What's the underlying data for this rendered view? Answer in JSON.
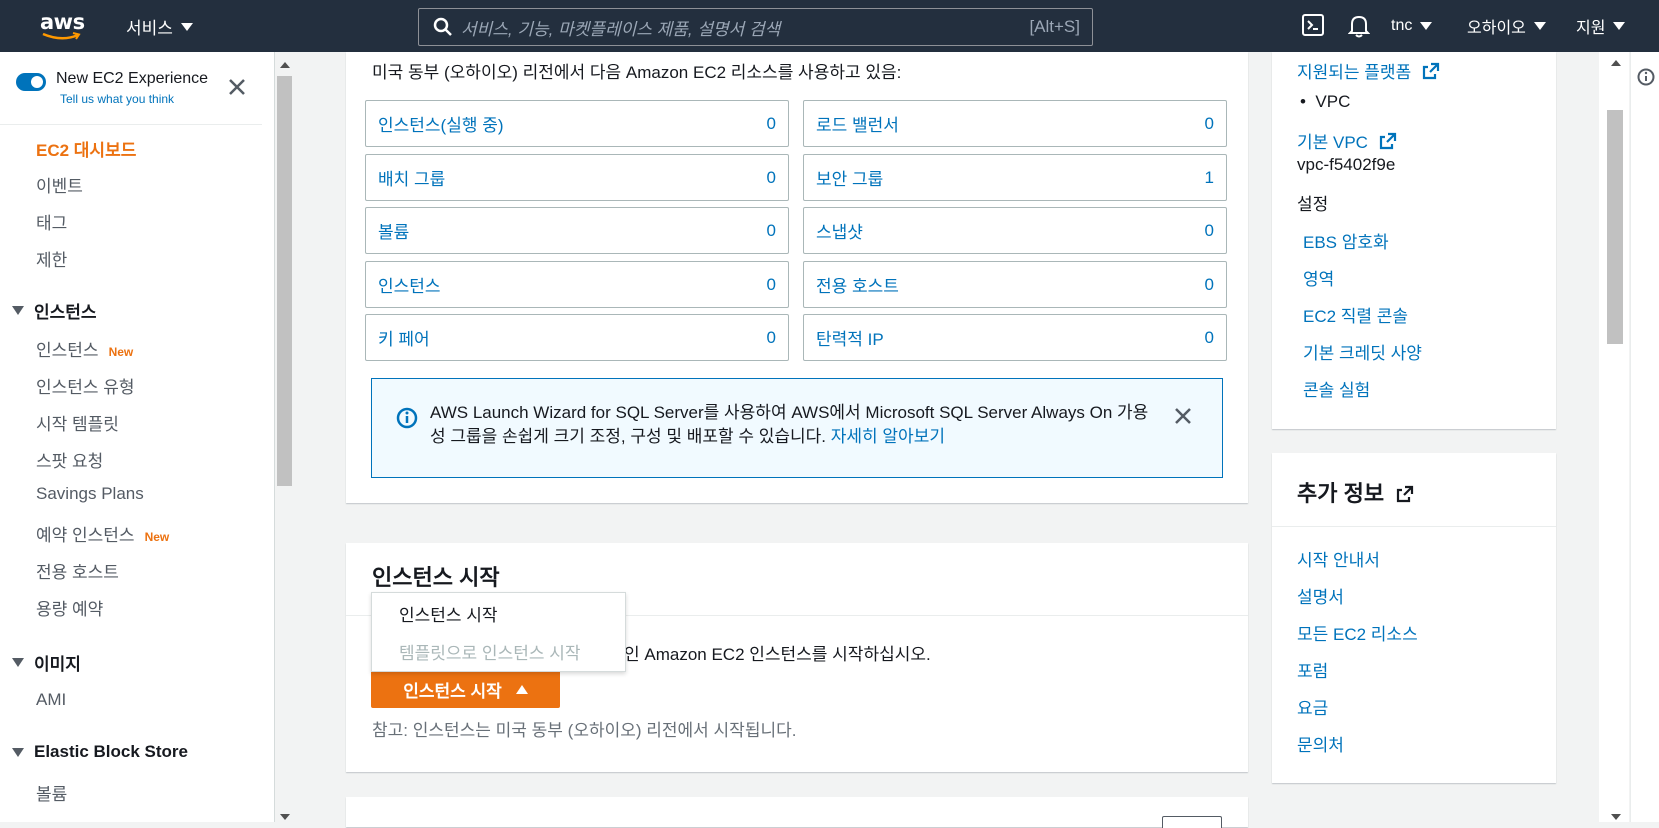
{
  "topnav": {
    "logo_text": "aws",
    "services_label": "서비스",
    "search_placeholder": "서비스, 기능, 마켓플레이스 제품, 설명서 검색",
    "search_shortcut": "[Alt+S]",
    "account_label": "tnc",
    "region_label": "오하이오",
    "support_label": "지원"
  },
  "sidebar": {
    "toggle_title": "New EC2 Experience",
    "toggle_link": "Tell us what you think",
    "dashboard": "EC2 대시보드",
    "events": "이벤트",
    "tags": "태그",
    "limits": "제한",
    "section_instances": "인스턴스",
    "instances": "인스턴스",
    "new_badge": "New",
    "instance_types": "인스턴스 유형",
    "launch_templates": "시작 템플릿",
    "spot_requests": "스팟 요청",
    "savings_plans": "Savings Plans",
    "reserved_instances": "예약 인스턴스",
    "new_badge2": "New",
    "dedicated_hosts": "전용 호스트",
    "capacity_reservations": "용량 예약",
    "section_images": "이미지",
    "ami": "AMI",
    "section_ebs": "Elastic Block Store",
    "volumes": "볼륨"
  },
  "resources": {
    "intro": "미국 동부 (오하이오) 리전에서 다음 Amazon EC2 리소스를 사용하고 있음:",
    "items": [
      {
        "label": "인스턴스(실행 중)",
        "count": "0"
      },
      {
        "label": "로드 밸런서",
        "count": "0"
      },
      {
        "label": "배치 그룹",
        "count": "0"
      },
      {
        "label": "보안 그룹",
        "count": "1"
      },
      {
        "label": "볼륨",
        "count": "0"
      },
      {
        "label": "스냅샷",
        "count": "0"
      },
      {
        "label": "인스턴스",
        "count": "0"
      },
      {
        "label": "전용 호스트",
        "count": "0"
      },
      {
        "label": "키 페어",
        "count": "0"
      },
      {
        "label": "탄력적 IP",
        "count": "0"
      }
    ]
  },
  "alert": {
    "message": "AWS Launch Wizard for SQL Server를 사용하여 AWS에서 Microsoft SQL Server Always On 가용성 그룹을 손쉽게 크기 조정, 구성 및 배포할 수 있습니다. ",
    "link": "자세히 알아보기"
  },
  "launch": {
    "title": "인스턴스 시작",
    "desc_suffix": "인 Amazon EC2 인스턴스를 시작하십시오.",
    "button_label": "인스턴스 시작",
    "note": "참고: 인스턴스는 미국 동부 (오하이오) 리전에서 시작됩니다.",
    "menu_items": [
      "인스턴스 시작",
      "템플릿으로 인스턴스 시작"
    ]
  },
  "attributes": {
    "supported_platforms": "지원되는 플랫폼",
    "platform_value": "VPC",
    "default_vpc": "기본 VPC",
    "vpc_id": "vpc-f5402f9e",
    "settings_label": "설정",
    "links": [
      "EBS 암호화",
      "영역",
      "EC2 직렬 콘솔",
      "기본 크레딧 사양",
      "콘솔 실험"
    ]
  },
  "additional_info": {
    "title": "추가 정보",
    "links": [
      "시작 안내서",
      "설명서",
      "모든 EC2 리소스",
      "포럼",
      "요금",
      "문의처"
    ]
  },
  "colors": {
    "nav_bg": "#232f3e",
    "accent": "#ec7211",
    "link": "#0073bb"
  }
}
